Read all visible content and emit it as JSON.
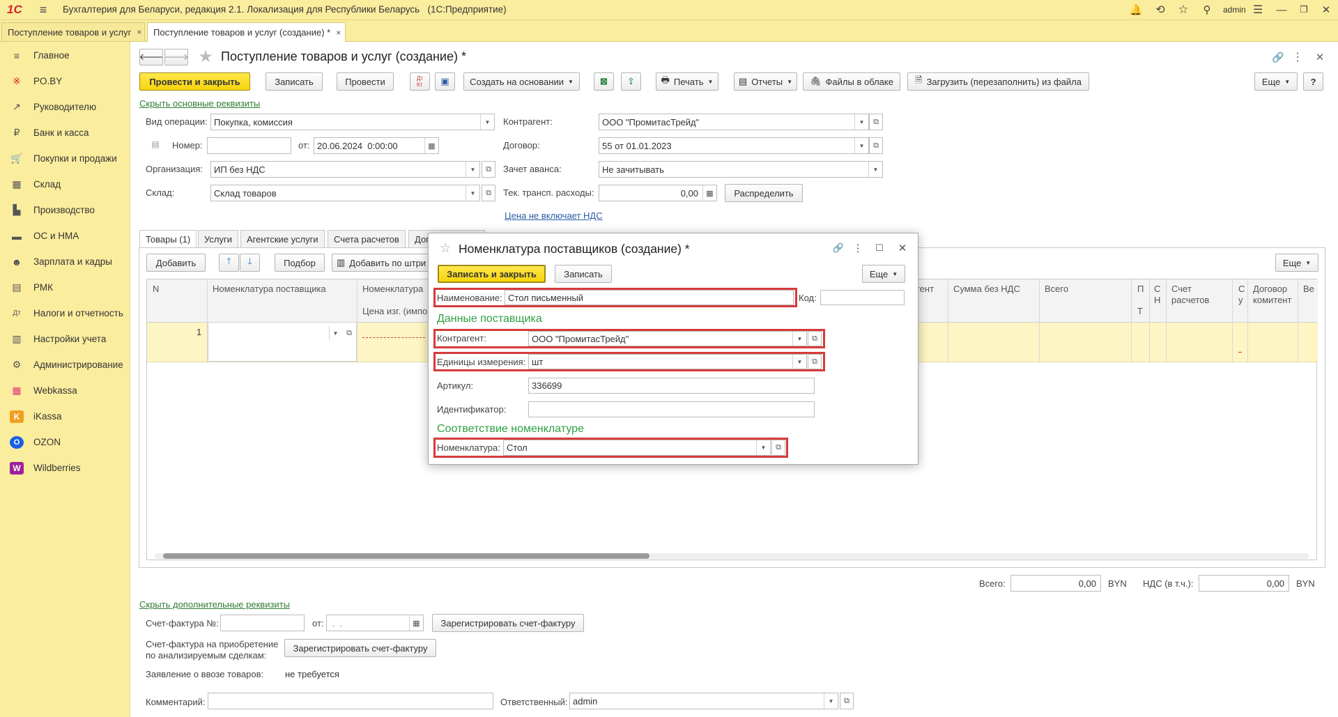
{
  "titlebar": {
    "logo": "1С",
    "title": "Бухгалтерия для Беларуси, редакция 2.1. Локализация для Республики Беларусь   (1С:Предприятие)",
    "user": "admin"
  },
  "tabs": [
    {
      "label": "Поступление товаров и услуг",
      "close": "×"
    },
    {
      "label": "Поступление товаров и услуг (создание) *",
      "close": "×"
    }
  ],
  "sidebar": {
    "items": [
      {
        "label": "Главное",
        "icon": "≡"
      },
      {
        "label": "PO.BY",
        "icon": "※"
      },
      {
        "label": "Руководителю",
        "icon": "↗"
      },
      {
        "label": "Банк и касса",
        "icon": "₽"
      },
      {
        "label": "Покупки и продажи",
        "icon": "🛒"
      },
      {
        "label": "Склад",
        "icon": "▦"
      },
      {
        "label": "Производство",
        "icon": "▙"
      },
      {
        "label": "ОС и НМА",
        "icon": "▬"
      },
      {
        "label": "Зарплата и кадры",
        "icon": "☻"
      },
      {
        "label": "РМК",
        "icon": "▤"
      },
      {
        "label": "Налоги и отчетность",
        "icon": "Дт"
      },
      {
        "label": "Настройки учета",
        "icon": "▥"
      },
      {
        "label": "Администрирование",
        "icon": "⚙"
      },
      {
        "label": "Webkassa",
        "icon": "▦"
      },
      {
        "label": "iKassa",
        "icon": "K"
      },
      {
        "label": "OZON",
        "icon": "O"
      },
      {
        "label": "Wildberries",
        "icon": "W"
      }
    ]
  },
  "form": {
    "title": "Поступление товаров и услуг (создание) *",
    "toolbar": {
      "post_close": "Провести и закрыть",
      "save": "Записать",
      "post": "Провести",
      "create_based": "Создать на основании",
      "print": "Печать",
      "reports": "Отчеты",
      "cloud_files": "Файлы в облаке",
      "load_file": "Загрузить (перезаполнить) из файла",
      "more": "Еще",
      "help": "?"
    },
    "hide_main_link": "Скрыть основные реквизиты",
    "fields": {
      "operation_label": "Вид операции:",
      "operation_value": "Покупка, комиссия",
      "number_label": "Номер:",
      "number_value": "",
      "date_label": "от:",
      "date_value": "20.06.2024  0:00:00",
      "org_label": "Организация:",
      "org_value": "ИП без НДС",
      "warehouse_label": "Склад:",
      "warehouse_value": "Склад товаров",
      "counterparty_label": "Контрагент:",
      "counterparty_value": "ООО \"ПромитасТрейд\"",
      "contract_label": "Договор:",
      "contract_value": "55 от 01.01.2023",
      "advance_label": "Зачет аванса:",
      "advance_value": "Не зачитывать",
      "transport_label": "Тек. трансп. расходы:",
      "transport_value": "0,00",
      "distribute": "Распределить",
      "vat_link": "Цена не включает НДС"
    },
    "tabs": [
      "Товары (1)",
      "Услуги",
      "Агентские услуги",
      "Счета расчетов",
      "Доп"
    ],
    "table_toolbar": {
      "add": "Добавить",
      "pick": "Подбор",
      "barcode": "Добавить по штри",
      "more": "Еще"
    },
    "table_headers": {
      "n": "N",
      "supplier_item": "Номенклатура поставщика",
      "item": "Номенклатура",
      "price_sub": "Цена изг. (импо",
      "agent": "агент",
      "sum_no_vat": "Сумма без НДС",
      "total": "Всего",
      "p": "П",
      "t": "Т",
      "sn_top": "С",
      "sn_bottom": "Н",
      "account_top": "Счет",
      "account_bottom": "расчетов",
      "o_top": "С",
      "o_bottom": "у",
      "commitent_top": "Договор",
      "commitent_bottom": "комитент",
      "ve": "Ве"
    },
    "rows": [
      {
        "n": "1"
      }
    ],
    "totals": {
      "total_label": "Всего:",
      "total_value": "0,00",
      "currency": "BYN",
      "vat_label": "НДС (в т.ч.):",
      "vat_value": "0,00",
      "vat_currency": "BYN"
    },
    "hide_extra_link": "Скрыть дополнительные реквизиты",
    "invoice": {
      "label": "Счет-фактура №:",
      "value": "",
      "date_label": "от:",
      "date_value": " .  .",
      "register": "Зарегистрировать счет-фактуру",
      "purchase_label_1": "Счет-фактура на приобретение",
      "purchase_label_2": "по анализируемым сделкам:",
      "purchase_register": "Зарегистрировать счет-фактуру",
      "import_label": "Заявление о ввозе товаров:",
      "import_value": "не требуется",
      "comment_label": "Комментарий:",
      "comment_value": "",
      "responsible_label": "Ответственный:",
      "responsible_value": "admin"
    }
  },
  "dialog": {
    "title": "Номенклатура поставщиков (создание) *",
    "save_close": "Записать и закрыть",
    "save": "Записать",
    "more": "Еще",
    "name_label": "Наименование:",
    "name_value": "Стол письменный",
    "code_label": "Код:",
    "code_value": "",
    "supplier_section": "Данные поставщика",
    "counterparty_label": "Контрагент:",
    "counterparty_value": "ООО \"ПромитасТрейд\"",
    "unit_label": "Единицы измерения:",
    "unit_value": "шт",
    "article_label": "Артикул:",
    "article_value": "336699",
    "identifier_label": "Идентификатор:",
    "identifier_value": "",
    "match_section": "Соответствие номенклатуре",
    "item_label": "Номенклатура:",
    "item_value": "Стол"
  },
  "colors": {
    "accent_yellow": "#fbed9e",
    "primary_button": "#f6d40b",
    "highlight_red": "#d63b3b",
    "section_green": "#2ea043",
    "link_green": "#2e7d32"
  }
}
